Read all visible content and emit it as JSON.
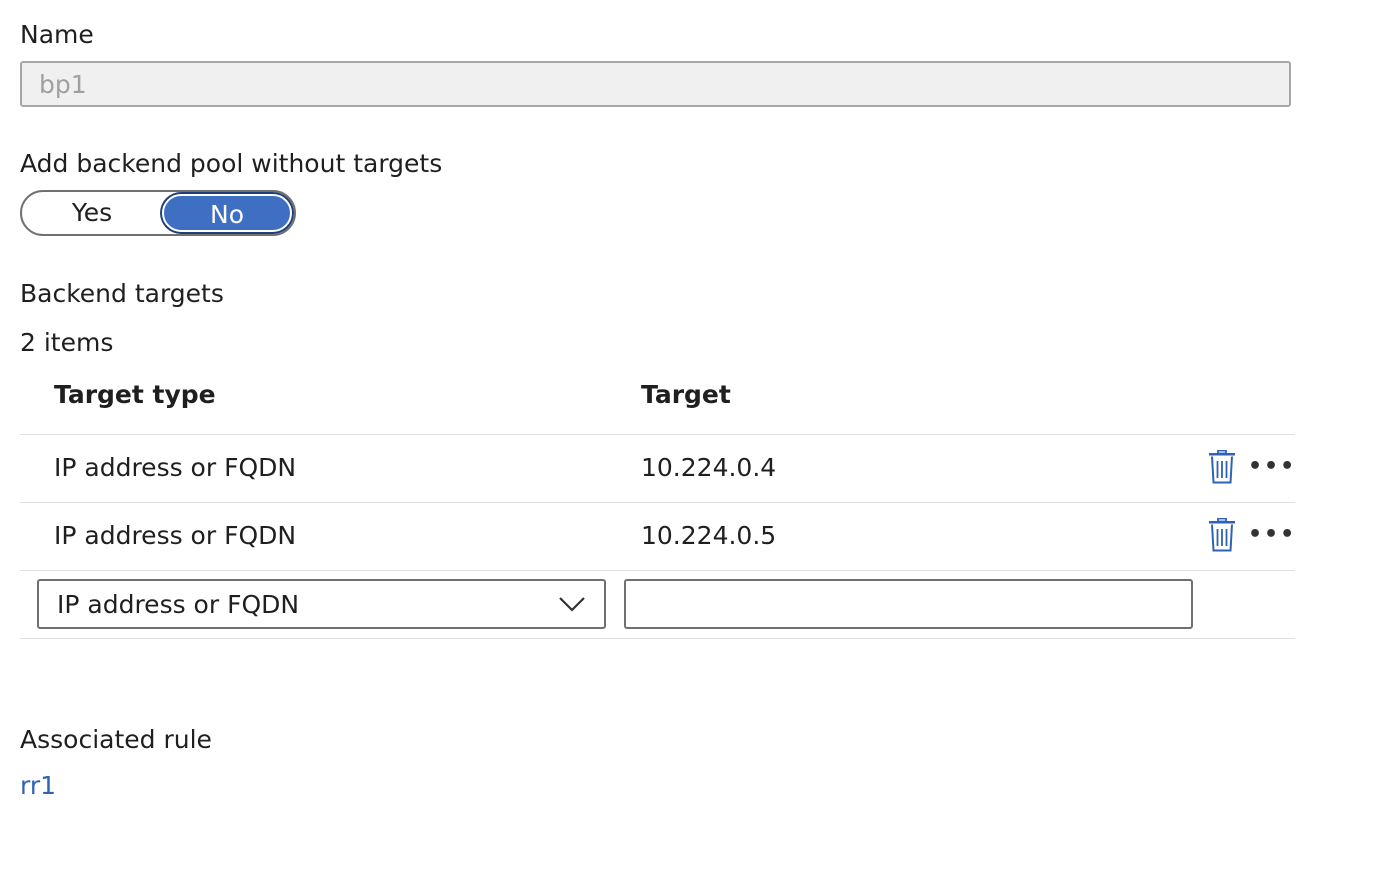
{
  "name_field": {
    "label": "Name",
    "value": "bp1"
  },
  "pool_option": {
    "label": "Add backend pool without targets",
    "options": [
      "Yes",
      "No"
    ],
    "selected": "No"
  },
  "backend_targets": {
    "heading": "Backend targets",
    "count_text": "2 items",
    "columns": [
      "Target type",
      "Target"
    ],
    "rows": [
      {
        "type": "IP address or FQDN",
        "target": "10.224.0.4"
      },
      {
        "type": "IP address or FQDN",
        "target": "10.224.0.5"
      }
    ],
    "new_row": {
      "type_selected": "IP address or FQDN",
      "target_value": ""
    }
  },
  "associated_rule": {
    "label": "Associated rule",
    "link": "rr1"
  },
  "colors": {
    "accent": "#3e6fc2",
    "link": "#2d62b8",
    "icon": "#2d62b8"
  }
}
